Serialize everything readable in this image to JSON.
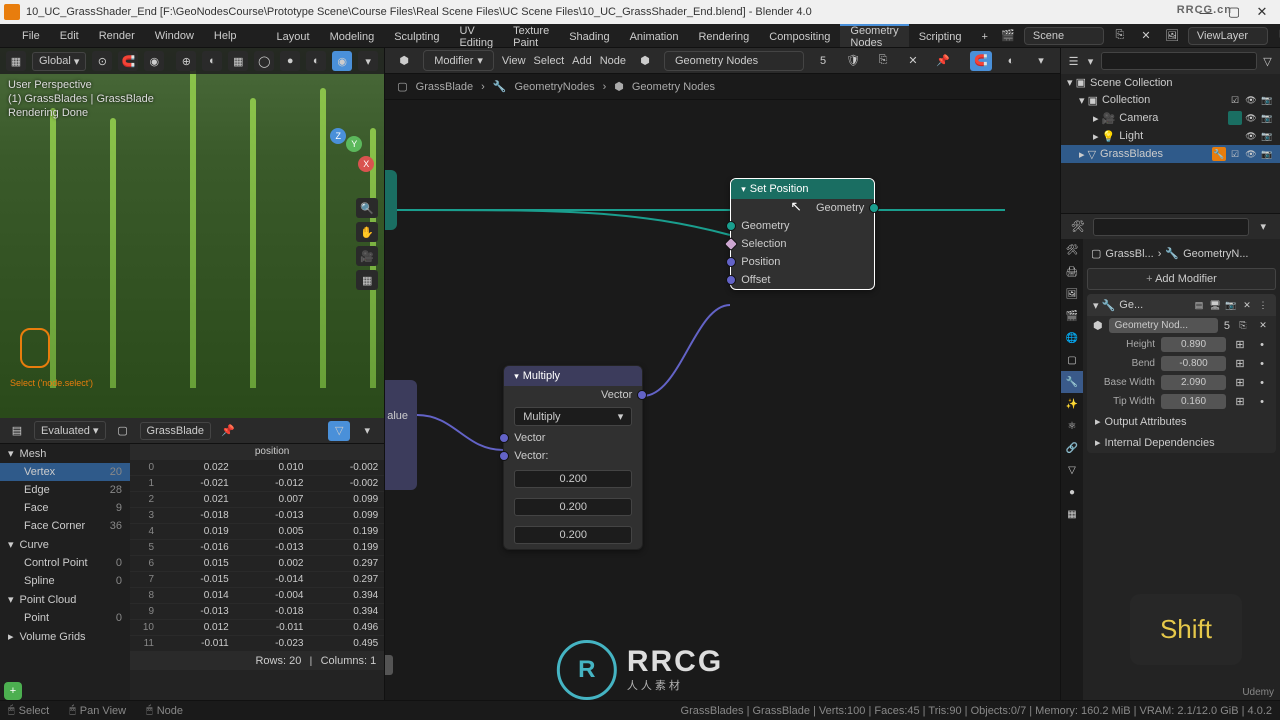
{
  "window": {
    "title": "10_UC_GrassShader_End [F:\\GeoNodesCourse\\Prototype Scene\\Course Files\\Real Scene Files\\UC Scene Files\\10_UC_GrassShader_End.blend] - Blender 4.0"
  },
  "menu": {
    "file": "File",
    "edit": "Edit",
    "render": "Render",
    "window": "Window",
    "help": "Help"
  },
  "workspaces": [
    "Layout",
    "Modeling",
    "Sculpting",
    "UV Editing",
    "Texture Paint",
    "Shading",
    "Animation",
    "Rendering",
    "Compositing",
    "Geometry Nodes",
    "Scripting"
  ],
  "workspace_active": "Geometry Nodes",
  "topbar_right": {
    "scene": "Scene",
    "viewlayer": "ViewLayer"
  },
  "viewport_header": {
    "orientation": "Global"
  },
  "viewport_overlay": {
    "line1": "User Perspective",
    "line2": "(1) GrassBlades | GrassBlade",
    "line3": "Rendering Done"
  },
  "viewport_bottom_label": "Select ('node.select')",
  "node_editor": {
    "menus": [
      "View",
      "Select",
      "Add",
      "Node"
    ],
    "type": "Modifier",
    "name": "Geometry Nodes",
    "users": "5",
    "breadcrumb": [
      "GrassBlade",
      "GeometryNodes",
      "Geometry Nodes"
    ]
  },
  "nodes": {
    "set_position": {
      "title": "Set Position",
      "out_geometry": "Geometry",
      "in_geometry": "Geometry",
      "in_selection": "Selection",
      "in_position": "Position",
      "in_offset": "Offset"
    },
    "multiply": {
      "title": "Multiply",
      "out_vector": "Vector",
      "operation": "Multiply",
      "in_vector": "Vector",
      "in_vector2": "Vector:",
      "vx": "0.200",
      "vy": "0.200",
      "vz": "0.200"
    },
    "partial_value": "alue"
  },
  "spreadsheet": {
    "mode": "Evaluated",
    "object": "GrassBlade",
    "col_header": "position",
    "tree": {
      "mesh": "Mesh",
      "vertex": "Vertex",
      "vertex_count": "20",
      "edge": "Edge",
      "edge_count": "28",
      "face": "Face",
      "face_count": "9",
      "face_corner": "Face Corner",
      "face_corner_count": "36",
      "curve": "Curve",
      "control_point": "Control Point",
      "control_point_count": "0",
      "spline": "Spline",
      "spline_count": "0",
      "point_cloud": "Point Cloud",
      "point": "Point",
      "point_count": "0",
      "volume_grids": "Volume Grids"
    },
    "rows": [
      {
        "i": "0",
        "x": "0.022",
        "y": "0.010",
        "z": "-0.002"
      },
      {
        "i": "1",
        "x": "-0.021",
        "y": "-0.012",
        "z": "-0.002"
      },
      {
        "i": "2",
        "x": "0.021",
        "y": "0.007",
        "z": "0.099"
      },
      {
        "i": "3",
        "x": "-0.018",
        "y": "-0.013",
        "z": "0.099"
      },
      {
        "i": "4",
        "x": "0.019",
        "y": "0.005",
        "z": "0.199"
      },
      {
        "i": "5",
        "x": "-0.016",
        "y": "-0.013",
        "z": "0.199"
      },
      {
        "i": "6",
        "x": "0.015",
        "y": "0.002",
        "z": "0.297"
      },
      {
        "i": "7",
        "x": "-0.015",
        "y": "-0.014",
        "z": "0.297"
      },
      {
        "i": "8",
        "x": "0.014",
        "y": "-0.004",
        "z": "0.394"
      },
      {
        "i": "9",
        "x": "-0.013",
        "y": "-0.018",
        "z": "0.394"
      },
      {
        "i": "10",
        "x": "0.012",
        "y": "-0.011",
        "z": "0.496"
      },
      {
        "i": "11",
        "x": "-0.011",
        "y": "-0.023",
        "z": "0.495"
      }
    ],
    "footer": {
      "rows": "Rows: 20",
      "cols": "Columns: 1"
    }
  },
  "outliner": {
    "scene_collection": "Scene Collection",
    "collection": "Collection",
    "camera": "Camera",
    "light": "Light",
    "grass": "GrassBlades"
  },
  "properties": {
    "breadcrumb_obj": "GrassBl...",
    "breadcrumb_mod": "GeometryN...",
    "add_modifier": "Add Modifier",
    "mod_short": "Ge...",
    "mod_data": "Geometry Nod...",
    "mod_users": "5",
    "height_label": "Height",
    "height": "0.890",
    "bend_label": "Bend",
    "bend": "-0.800",
    "basewidth_label": "Base Width",
    "basewidth": "2.090",
    "tipwidth_label": "Tip Width",
    "tipwidth": "0.160",
    "output_attrs": "Output Attributes",
    "internal_deps": "Internal Dependencies"
  },
  "statusbar": {
    "select": "Select",
    "pan": "Pan View",
    "node": "Node",
    "right": "GrassBlades | GrassBlade | Verts:100 | Faces:45 | Tris:90 | Objects:0/7 | Memory: 160.2 MiB | VRAM: 2.1/12.0 GiB | 4.0.2"
  },
  "overlay": {
    "shift": "Shift",
    "wm": "RRCG",
    "wm_sub": "人人素材",
    "corner": "RRCG.cn",
    "udemy": "Udemy"
  }
}
